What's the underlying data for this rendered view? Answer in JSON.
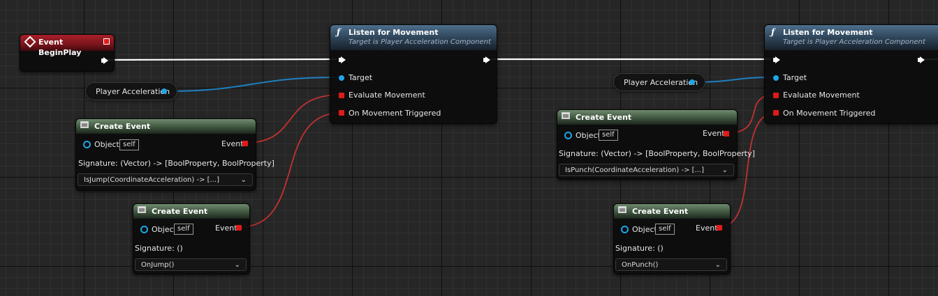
{
  "colors": {
    "exec_wire": "#ffffff",
    "object_wire": "#1e7fc0",
    "delegate_wire": "#c43131",
    "func_header": "#2c4154",
    "create_event_header": "#3f553f",
    "event_header": "#8a1a22"
  },
  "event_begin_play": {
    "title": "Event BeginPlay"
  },
  "listen_nodes": [
    {
      "title": "Listen for Movement",
      "subtitle": "Target is Player Acceleration Component",
      "pins": {
        "target": "Target",
        "evaluate": "Evaluate Movement",
        "triggered": "On Movement Triggered"
      }
    },
    {
      "title": "Listen for Movement",
      "subtitle": "Target is Player Acceleration Component",
      "pins": {
        "target": "Target",
        "evaluate": "Evaluate Movement",
        "triggered": "On Movement Triggered"
      }
    }
  ],
  "variables": [
    {
      "label": "Player Acceleration"
    },
    {
      "label": "Player Acceleration"
    }
  ],
  "create_events": [
    {
      "title": "Create Event",
      "object_label": "Object",
      "object_value": "self",
      "event_label": "Event",
      "signature": "Signature: (Vector) -> [BoolProperty, BoolProperty]",
      "function": "IsJump(CoordinateAcceleration) -> [...]"
    },
    {
      "title": "Create Event",
      "object_label": "Object",
      "object_value": "self",
      "event_label": "Event",
      "signature": "Signature: ()",
      "function": "OnJump()"
    },
    {
      "title": "Create Event",
      "object_label": "Object",
      "object_value": "self",
      "event_label": "Event",
      "signature": "Signature: (Vector) -> [BoolProperty, BoolProperty]",
      "function": "IsPunch(CoordinateAcceleration) -> [...]"
    },
    {
      "title": "Create Event",
      "object_label": "Object",
      "object_value": "self",
      "event_label": "Event",
      "signature": "Signature: ()",
      "function": "OnPunch()"
    }
  ],
  "icons": {
    "function": "function-icon",
    "create_event": "create-event-icon",
    "event": "event-diamond-icon",
    "dropdown": "chevron-down-icon"
  }
}
